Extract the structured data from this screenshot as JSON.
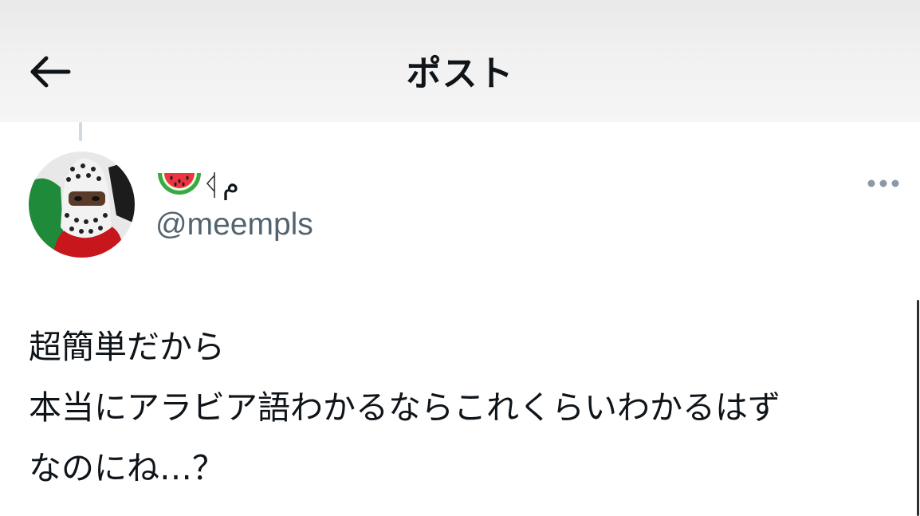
{
  "header": {
    "title": "ポスト",
    "back_icon": "arrow-left-icon"
  },
  "author": {
    "display_name": "م",
    "name_emoji": "watermelon-icon",
    "handle": "@meempls",
    "avatar": "avatar-image"
  },
  "more_icon": "more-horizontal-icon",
  "post": {
    "lines": [
      "超簡単だから",
      "本当にアラビア語わかるならこれくらいわかるはず",
      "なのにね…？"
    ]
  },
  "colors": {
    "text_primary": "#0f1419",
    "text_secondary": "#536471",
    "more_dots": "#8b98a5",
    "thread_line": "#cfd9de",
    "header_bg": "#f1f1f1"
  }
}
